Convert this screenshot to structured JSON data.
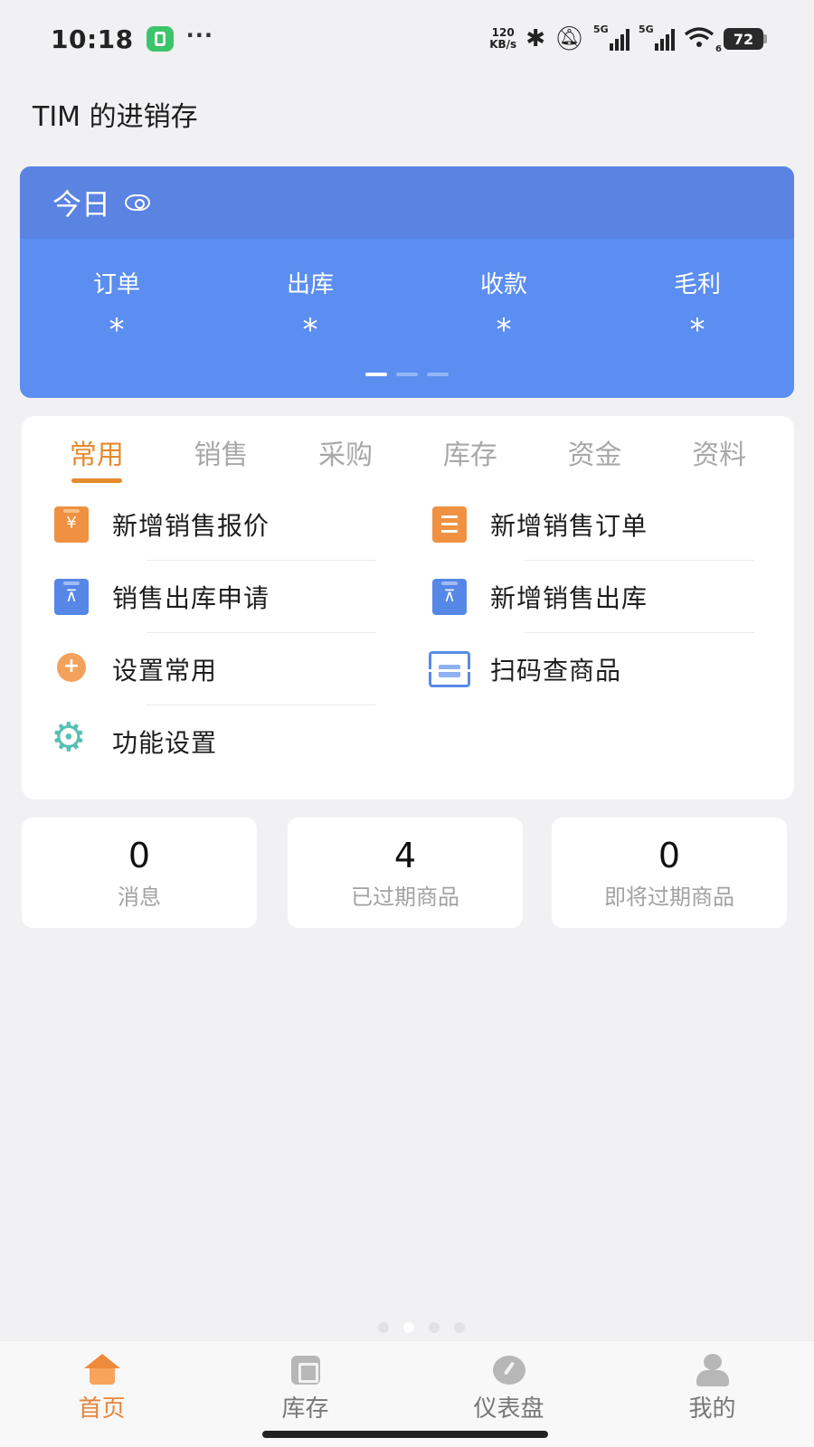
{
  "status_bar": {
    "time": "10:18",
    "more": "···",
    "net_speed_value": "120",
    "net_speed_unit": "KB/s",
    "sim1": "5G",
    "sim2": "5G",
    "wifi_label": "6",
    "battery": "72"
  },
  "header": {
    "title": "TIM 的进销存"
  },
  "today": {
    "title": "今日",
    "stats": [
      {
        "label": "订单",
        "value": "*"
      },
      {
        "label": "出库",
        "value": "*"
      },
      {
        "label": "收款",
        "value": "*"
      },
      {
        "label": "毛利",
        "value": "*"
      }
    ],
    "active_page": 1,
    "page_count": 3
  },
  "tabs": [
    {
      "label": "常用",
      "active": true
    },
    {
      "label": "销售",
      "active": false
    },
    {
      "label": "采购",
      "active": false
    },
    {
      "label": "库存",
      "active": false
    },
    {
      "label": "资金",
      "active": false
    },
    {
      "label": "资料",
      "active": false
    }
  ],
  "menu": [
    {
      "label": "新增销售报价",
      "icon": "sales-quote-icon"
    },
    {
      "label": "新增销售订单",
      "icon": "sales-order-icon"
    },
    {
      "label": "销售出库申请",
      "icon": "outbound-request-icon"
    },
    {
      "label": "新增销售出库",
      "icon": "outbound-icon"
    },
    {
      "label": "设置常用",
      "icon": "add-pin-icon"
    },
    {
      "label": "扫码查商品",
      "icon": "scan-icon"
    },
    {
      "label": "功能设置",
      "icon": "gear-icon"
    }
  ],
  "counters": [
    {
      "value": "0",
      "label": "消息"
    },
    {
      "value": "4",
      "label": "已过期商品"
    },
    {
      "value": "0",
      "label": "即将过期商品"
    }
  ],
  "bottom_nav": [
    {
      "label": "首页",
      "icon": "home-icon",
      "active": true
    },
    {
      "label": "库存",
      "icon": "box-icon",
      "active": false
    },
    {
      "label": "仪表盘",
      "icon": "gauge-icon",
      "active": false
    },
    {
      "label": "我的",
      "icon": "user-icon",
      "active": false
    }
  ],
  "colors": {
    "accent": "#e58a2e",
    "card_blue": "#5b8ef0",
    "card_head_blue": "#5b83e2",
    "background": "#f1f1f3"
  }
}
